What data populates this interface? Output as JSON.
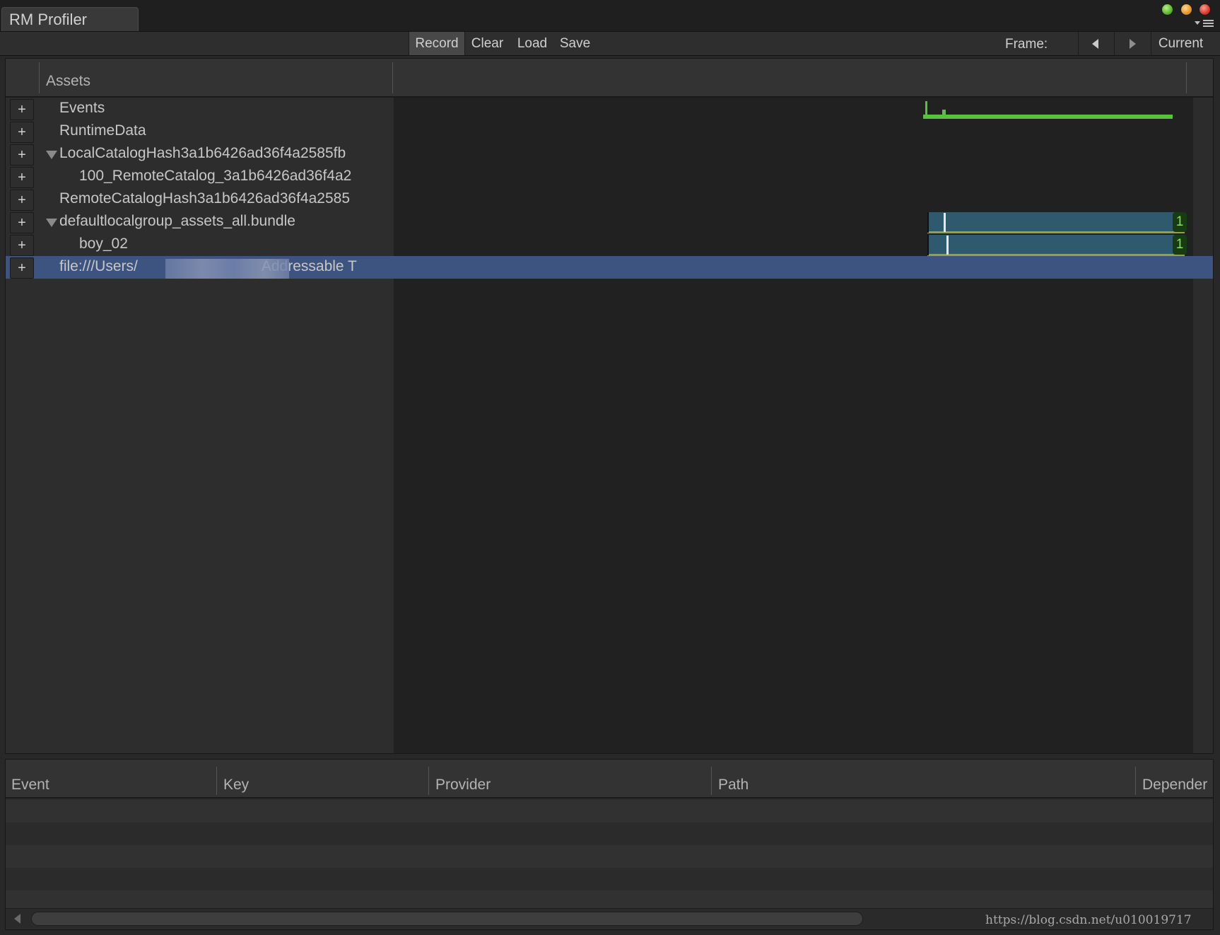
{
  "window": {
    "tab_title": "RM Profiler"
  },
  "toolbar": {
    "record_label": "Record",
    "clear_label": "Clear",
    "load_label": "Load",
    "save_label": "Save",
    "frame_label": "Frame:",
    "current_label": "Current"
  },
  "tree": {
    "column_header": "Assets",
    "nodes": [
      {
        "label": "Events",
        "expand_button": "+"
      },
      {
        "label": "RuntimeData",
        "expand_button": "+"
      },
      {
        "label": "LocalCatalogHash3a1b6426ad36f4a2585fb",
        "expand_button": "+",
        "expanded": true
      },
      {
        "label": "100_RemoteCatalog_3a1b6426ad36f4a2",
        "expand_button": "+"
      },
      {
        "label": "RemoteCatalogHash3a1b6426ad36f4a2585",
        "expand_button": "+"
      },
      {
        "label": "defaultlocalgroup_assets_all.bundle",
        "expand_button": "+",
        "expanded": true
      },
      {
        "label": "boy_02",
        "expand_button": "+"
      },
      {
        "label_start": "file:///Users/",
        "label_end": "Addressable T",
        "expand_button": "+",
        "selected": true
      }
    ]
  },
  "graph": {
    "bundle_ref_count": "1",
    "asset_ref_count": "1"
  },
  "events_table": {
    "columns": [
      "Event",
      "Key",
      "Provider",
      "Path",
      "Depender"
    ],
    "rows": []
  },
  "watermark": "https://blog.csdn.net/u010019717",
  "colors": {
    "selection": "#3d5480",
    "event_line": "#57c23b",
    "bar_fill": "#2f5a6e",
    "count_text": "#8fdc4e"
  }
}
